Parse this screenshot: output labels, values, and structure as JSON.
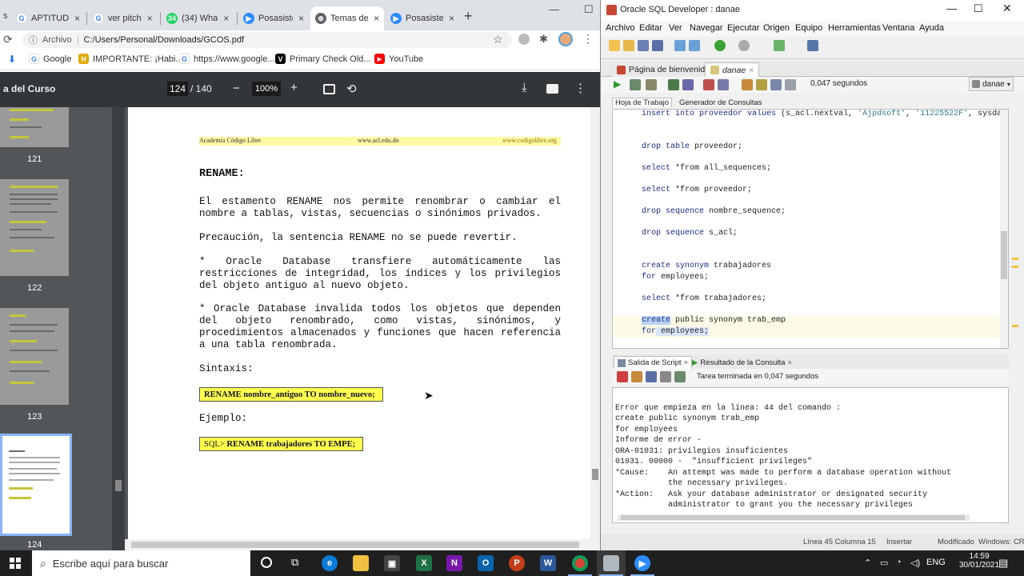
{
  "chrome": {
    "tabs": [
      {
        "label": "APTITUD",
        "fav_color": "#1a73e8",
        "fav_text": "G"
      },
      {
        "label": "ver pitch",
        "fav_color": "#4285f4",
        "fav_text": "G"
      },
      {
        "label": "(34) Wha",
        "fav_color": "#25d366",
        "fav_text": "34"
      },
      {
        "label": "Posasiste",
        "fav_color": "#2d8cff",
        "fav_text": "▶"
      },
      {
        "label": "Temas de",
        "fav_color": "#5f6368",
        "fav_text": "⊕"
      },
      {
        "label": "Posasiste",
        "fav_color": "#2d8cff",
        "fav_text": "▶"
      }
    ],
    "new_tab": "+",
    "controls": {
      "minimize": "—",
      "maximize": "☐"
    },
    "address": {
      "label": "Archivo",
      "url": "C:/Users/Personal/Downloads/GCOS.pdf"
    },
    "bookmarks": [
      {
        "label": "Google",
        "color": "#4285f4",
        "icon": "G"
      },
      {
        "label": "IMPORTANTE: ¡Habi...",
        "color": "#e0a800",
        "icon": "H"
      },
      {
        "label": "https://www.google....",
        "color": "#4285f4",
        "icon": "G"
      },
      {
        "label": "Primary Check Old...",
        "color": "#000000",
        "icon": "V"
      },
      {
        "label": "YouTube",
        "color": "#ff0000",
        "icon": "▶"
      }
    ]
  },
  "pdf": {
    "title": "a del Curso",
    "page_current": "124",
    "page_total": "/ 140",
    "zoom": "100%",
    "thumb_numbers": [
      "121",
      "122",
      "123",
      "124"
    ],
    "header": {
      "left": "Academia Código Libre",
      "center": "www.acl.edu.do",
      "right": "www.codigolibre.org"
    },
    "heading": "RENAME:",
    "p1": "El estamento RENAME nos permite renombrar o cambiar el nombre a tablas, vistas, secuencias o sinónimos privados.",
    "p2": "Precaución, la sentencia RENAME no se puede revertir.",
    "p3": "* Oracle Database transfiere automáticamente las restricciones de integridad, los índices y los privilegios del objeto antiguo al nuevo objeto.",
    "p4": "* Oracle Database invalida todos los objetos que dependen del objeto renombrado, como vistas, sinónimos, y procedimientos almacenados y funciones que hacen referencia a una tabla renombrada.",
    "syntax_label": "Sintaxis:",
    "syntax_box": "RENAME nombre_antiguo TO nombre_nuevo;",
    "example_label": "Ejemplo:",
    "example_prompt": "SQL>",
    "example_box": "RENAME trabajadores TO EMPE;"
  },
  "sqldev": {
    "title": "Oracle SQL Developer : danae",
    "menu": [
      "Archivo",
      "Editar",
      "Ver",
      "Navegar",
      "Ejecutar",
      "Origen",
      "Equipo",
      "Herramientas",
      "Ventana",
      "Ayuda"
    ],
    "doc_tabs": [
      "Página de bienvenida",
      "danae"
    ],
    "exec_time": "0,047 segundos",
    "connection": "danae",
    "ws_tabs": [
      "Hoja de Trabajo",
      "Generador de Consultas"
    ],
    "code_lines": [
      {
        "kw": "insert into proveedor values",
        "rest": " (s_acl.nextval, ",
        "s1": "'Ajpdsoft'",
        "mid": ", ",
        "s2": "'11225522F'",
        "end": ", sysdate);"
      },
      {
        "kw": "drop table",
        "rest": " proveedor;"
      },
      {
        "kw": "select",
        "rest": " *from all_sequences;"
      },
      {
        "kw": "select",
        "rest": " *from proveedor;"
      },
      {
        "kw": "drop sequence",
        "rest": " nombre_sequence;"
      },
      {
        "kw": "drop sequence",
        "rest": " s_acl;"
      },
      {
        "kw": "create synonym",
        "rest": " trabajadores"
      },
      {
        "kw": "for",
        "rest": " employees;"
      },
      {
        "kw": "select",
        "rest": " *from trabajadores;"
      },
      {
        "kw": "create",
        "rest": " public synonym trab_emp"
      },
      {
        "kw": "for",
        "rest": " employees;"
      }
    ],
    "out_tabs": [
      "Salida de Script",
      "Resultado de la Consulta"
    ],
    "task_done": "Tarea terminada en 0,047 segundos",
    "output_lines": [
      "Error que empieza en la línea: 44 del comando :",
      "create public synonym trab_emp",
      "for employees",
      "Informe de error -",
      "ORA-01031: privilegios insuficientes",
      "01031. 00000 -  \"insufficient privileges\"",
      "*Cause:    An attempt was made to perform a database operation without",
      "           the necessary privileges.",
      "*Action:   Ask your database administrator or designated security",
      "           administrator to grant you the necessary privileges"
    ],
    "status": {
      "position": "Línea 45 Columna 15",
      "mode": "Insertar",
      "modified": "Modificado",
      "os": "Windows: CR"
    }
  },
  "taskbar": {
    "search_placeholder": "Escribe aquí para buscar",
    "lang": "ENG",
    "time": "14:59",
    "date": "30/01/2021"
  }
}
